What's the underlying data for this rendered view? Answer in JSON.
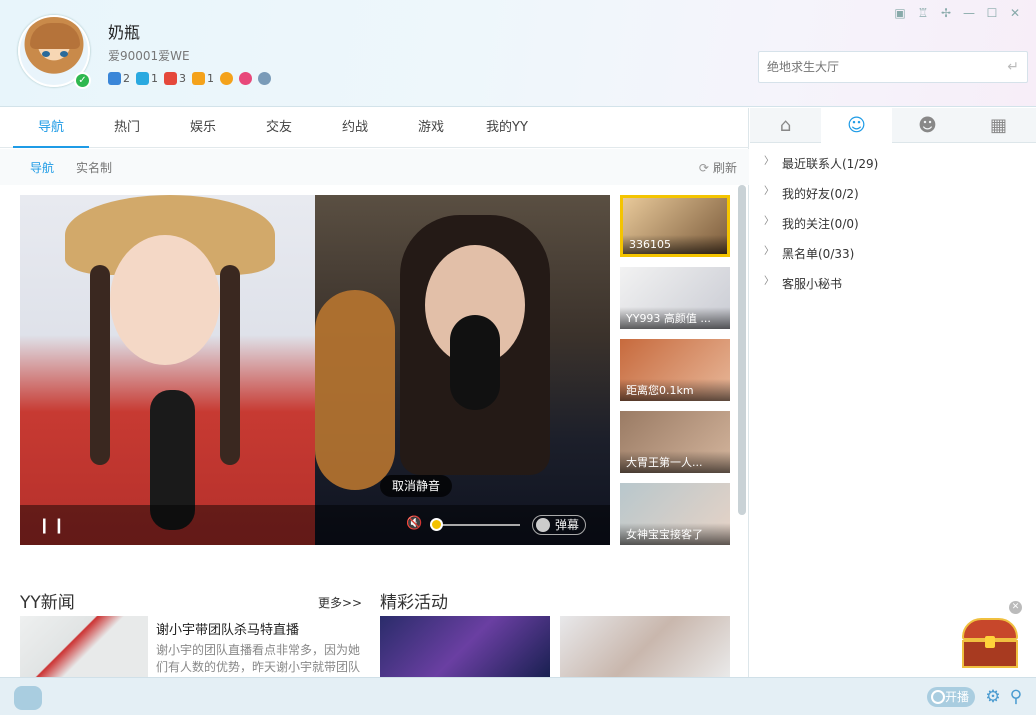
{
  "user": {
    "nickname": "奶瓶",
    "signature": "爱90001爱WE",
    "badges": [
      {
        "icon": "game-icon",
        "count": "2",
        "color": "#3a86d8"
      },
      {
        "icon": "diamond-icon",
        "count": "1",
        "color": "#2aa9e0"
      },
      {
        "icon": "vip-icon",
        "count": "3",
        "color": "#e5483b"
      },
      {
        "icon": "level-icon",
        "count": "1",
        "color": "#f4a21b"
      },
      {
        "icon": "smile-icon",
        "count": "",
        "color": "#f4a21b"
      },
      {
        "icon": "heart-icon",
        "count": "",
        "color": "#e8487a"
      },
      {
        "icon": "eye-icon",
        "count": "",
        "color": "#7a9bb8"
      }
    ]
  },
  "window_controls": [
    "skin-icon",
    "shirt-icon",
    "pin-icon",
    "minimize-icon",
    "maximize-icon",
    "close-icon"
  ],
  "search": {
    "placeholder": "绝地求生大厅"
  },
  "main_tabs": [
    "导航",
    "热门",
    "娱乐",
    "交友",
    "约战",
    "游戏",
    "我的YY"
  ],
  "sub_nav": {
    "items": [
      "导航",
      "实名制"
    ],
    "refresh": "刷新"
  },
  "video": {
    "tooltip": "取消静音",
    "danmu_label": "弹幕",
    "volume": 0.0
  },
  "thumbs": [
    {
      "caption": "336105",
      "selected": true
    },
    {
      "caption": "YY993 高颜值 ...",
      "selected": false
    },
    {
      "caption": "距离您0.1km",
      "selected": false
    },
    {
      "caption": "大胃王第一人...",
      "selected": false
    },
    {
      "caption": "女神宝宝接客了",
      "selected": false
    }
  ],
  "news": {
    "section_title": "YY新闻",
    "more": "更多>>",
    "headline": "谢小宇带团队杀马特直播",
    "desc": "谢小宇的团队直播看点非常多，因为她们有人数的优势，昨天谢小宇就带团队"
  },
  "activity": {
    "section_title": "精彩活动"
  },
  "right_tabs": [
    "home-icon",
    "contact-icon",
    "group-icon",
    "apps-icon"
  ],
  "contacts": [
    "最近联系人(1/29)",
    "我的好友(0/2)",
    "我的关注(0/0)",
    "黑名单(0/33)",
    "客服小秘书"
  ],
  "footer": {
    "live": "开播"
  }
}
